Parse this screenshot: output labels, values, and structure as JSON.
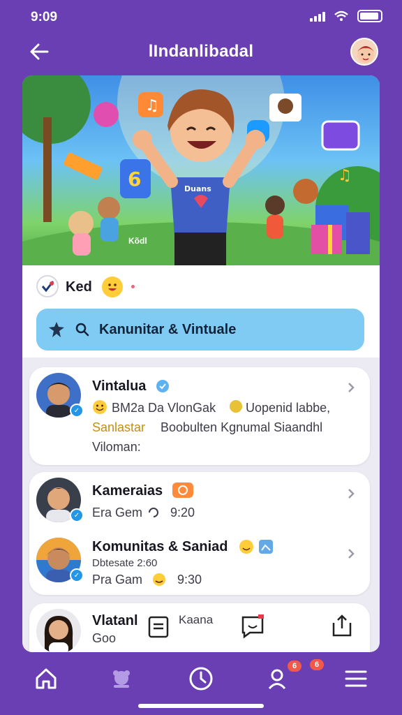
{
  "status": {
    "time": "9:09"
  },
  "header": {
    "title": "lIndanlibadal"
  },
  "hero": {
    "caption": "Kõdl",
    "shirt_text": "Duans"
  },
  "profile": {
    "name": "Ked"
  },
  "search": {
    "text": "Kanunitar & Vintuale"
  },
  "cards": [
    {
      "name": "Vintalua",
      "lines": [
        "BM2a Da VlonGak",
        "Uopenid labbe,",
        "Sanlastar",
        "Boobulten Kgnumal Siaandhl",
        "Viloman:"
      ]
    },
    {
      "name": "Kameraias",
      "line": "Era Gem",
      "time": "9:20"
    },
    {
      "name": "Komunitas & Saniad",
      "line1": "Dbtesate 2:60",
      "line2": "Pra Gam",
      "time": "9:30"
    },
    {
      "name": "Vlatanl",
      "line": "Goo",
      "action": "Kaana"
    }
  ],
  "nav": {
    "badge1": "6",
    "badge2": "6"
  },
  "colors": {
    "background": "#6a3fb3",
    "search": "#80cbf3",
    "accent": "#2496e8"
  },
  "icons": [
    "arrow-left-icon",
    "search-icon",
    "home-icon",
    "community-icon",
    "clock-icon",
    "people-icon",
    "menu-icon",
    "share-icon"
  ]
}
